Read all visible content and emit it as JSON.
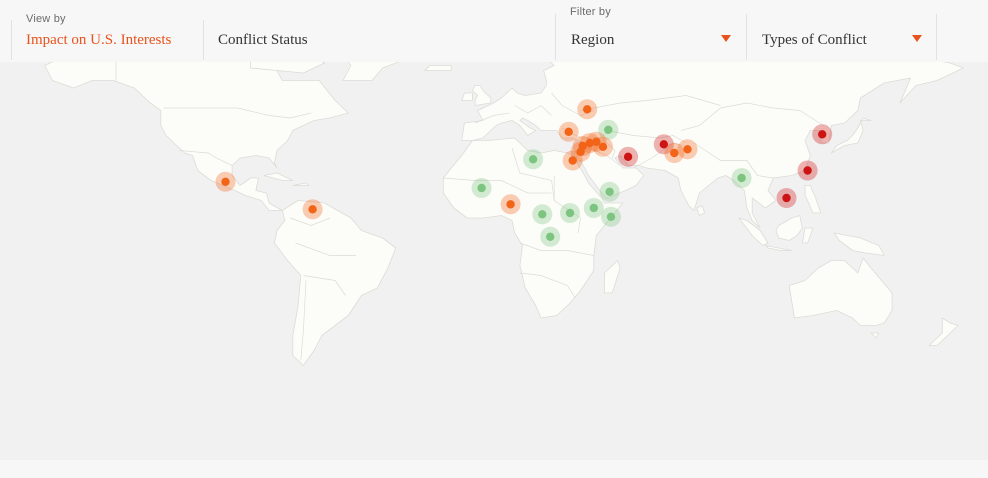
{
  "toolbar": {
    "view_by_label": "View by",
    "tabs": [
      {
        "label": "Impact on U.S. Interests",
        "active": true
      },
      {
        "label": "Conflict Status",
        "active": false
      }
    ],
    "filter_by_label": "Filter by",
    "filters": [
      {
        "label": "Region"
      },
      {
        "label": "Types of Conflict"
      }
    ],
    "accent_color": "#e8521c"
  },
  "map": {
    "colors": {
      "land": "#fcfcf9",
      "ocean": "#f1f1f2",
      "border": "#dcdcd6",
      "critical": "#cc1414",
      "significant": "#f26418",
      "limited": "#7cc47f"
    },
    "markers": [
      {
        "name": "Mexico",
        "lat": 19.5,
        "lon": -99.5,
        "impact": "significant"
      },
      {
        "name": "Venezuela",
        "lat": 8.5,
        "lon": -66.5,
        "impact": "significant"
      },
      {
        "name": "Ukraine",
        "lat": 48.5,
        "lon": 37.5,
        "impact": "significant"
      },
      {
        "name": "Turkey",
        "lat": 39.5,
        "lon": 30.5,
        "impact": "significant"
      },
      {
        "name": "Caucasus",
        "lat": 40.3,
        "lon": 45.5,
        "impact": "limited"
      },
      {
        "name": "Syria",
        "lat": 35.0,
        "lon": 38.5,
        "impact": "significant"
      },
      {
        "name": "Iraq",
        "lat": 33.5,
        "lon": 43.5,
        "impact": "significant"
      },
      {
        "name": "Lebanon",
        "lat": 33.8,
        "lon": 35.8,
        "impact": "significant"
      },
      {
        "name": "Israel-Palestine",
        "lat": 31.5,
        "lon": 35.0,
        "impact": "significant"
      },
      {
        "name": "Kurdistan",
        "lat": 35.5,
        "lon": 41.0,
        "impact": "significant"
      },
      {
        "name": "Egypt",
        "lat": 28.0,
        "lon": 32.0,
        "impact": "significant"
      },
      {
        "name": "Libya",
        "lat": 28.5,
        "lon": 17.0,
        "impact": "limited"
      },
      {
        "name": "Mali",
        "lat": 17.0,
        "lon": -2.5,
        "impact": "limited"
      },
      {
        "name": "Nigeria",
        "lat": 10.5,
        "lon": 8.5,
        "impact": "significant"
      },
      {
        "name": "Central African Republic",
        "lat": 6.5,
        "lon": 20.5,
        "impact": "limited"
      },
      {
        "name": "DR Congo",
        "lat": -2.5,
        "lon": 23.5,
        "impact": "limited"
      },
      {
        "name": "South Sudan",
        "lat": 7.0,
        "lon": 31.0,
        "impact": "limited"
      },
      {
        "name": "Ethiopia",
        "lat": 9.0,
        "lon": 40.0,
        "impact": "limited"
      },
      {
        "name": "Somalia",
        "lat": 5.5,
        "lon": 46.5,
        "impact": "limited"
      },
      {
        "name": "Yemen",
        "lat": 15.5,
        "lon": 46.0,
        "impact": "limited"
      },
      {
        "name": "Iran",
        "lat": 29.5,
        "lon": 53.0,
        "impact": "critical"
      },
      {
        "name": "Afghanistan",
        "lat": 34.5,
        "lon": 66.5,
        "impact": "critical"
      },
      {
        "name": "Pakistan",
        "lat": 31.0,
        "lon": 70.5,
        "impact": "significant"
      },
      {
        "name": "India-Pakistan",
        "lat": 32.5,
        "lon": 75.5,
        "impact": "significant"
      },
      {
        "name": "Myanmar",
        "lat": 21.0,
        "lon": 96.0,
        "impact": "limited"
      },
      {
        "name": "Korean Peninsula",
        "lat": 38.5,
        "lon": 126.5,
        "impact": "critical"
      },
      {
        "name": "Taiwan",
        "lat": 24.0,
        "lon": 121.0,
        "impact": "critical"
      },
      {
        "name": "South China Sea",
        "lat": 13.0,
        "lon": 113.0,
        "impact": "critical"
      }
    ]
  }
}
